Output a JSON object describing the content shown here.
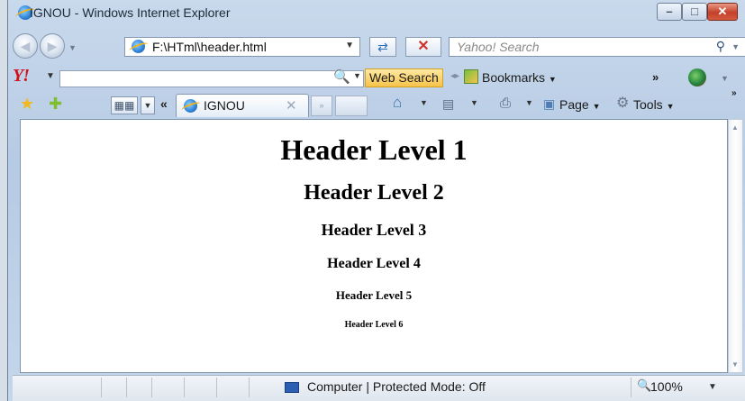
{
  "window": {
    "title": "IGNOU - Windows Internet Explorer"
  },
  "caption_buttons": {
    "minimize": "–",
    "maximize": "□",
    "close": "✕"
  },
  "address_bar": {
    "url": "F:\\HTml\\header.html",
    "back": "◀",
    "forward": "▶"
  },
  "search": {
    "placeholder": "Yahoo! Search"
  },
  "yahoo_toolbar": {
    "logo": "Y!",
    "web_search_label": "Web Search",
    "bookmarks_label": "Bookmarks",
    "overflow": "»"
  },
  "tabs": [
    {
      "label": "IGNOU"
    }
  ],
  "command_bar": {
    "page_label": "Page",
    "tools_label": "Tools",
    "overflow": "»"
  },
  "page": {
    "headers": [
      "Header Level 1",
      "Header Level 2",
      "Header Level 3",
      "Header Level 4",
      "Header Level 5",
      "Header Level 6"
    ]
  },
  "status_bar": {
    "zone": "Computer | Protected Mode: Off",
    "zoom": "100%"
  },
  "icons": {
    "browser": "ie-icon",
    "favorites": "star-icon",
    "add_favorite": "add-favorite-icon",
    "home": "home-icon",
    "feeds": "rss-icon",
    "print": "print-icon",
    "page": "page-icon",
    "tools": "gear-icon",
    "zone": "computer-icon",
    "zoom": "magnifier-icon"
  },
  "colors": {
    "yahoo_red": "#d4101c",
    "web_search_bg": "#f6c34a",
    "window_frame": "#b6cbe4"
  }
}
